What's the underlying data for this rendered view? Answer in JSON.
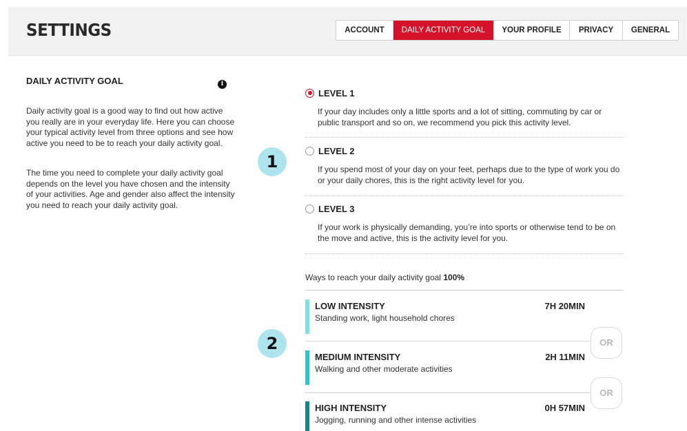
{
  "header": {
    "title": "SETTINGS",
    "tabs": [
      {
        "label": "ACCOUNT",
        "active": false
      },
      {
        "label": "DAILY ACTIVITY GOAL",
        "active": true
      },
      {
        "label": "YOUR PROFILE",
        "active": false
      },
      {
        "label": "PRIVACY",
        "active": false
      },
      {
        "label": "GENERAL",
        "active": false
      }
    ]
  },
  "sidebar": {
    "title": "DAILY ACTIVITY GOAL",
    "info_icon": "info-icon",
    "paragraph1": "Daily activity goal is a good way to find out how active you really are in your everyday life. Here you can choose your typical activity level from three options and see how active you need to be to reach your daily activity goal.",
    "paragraph2": "The time you need to complete your daily activity goal depends on the level you have chosen and the intensity of your activities. Age and gender also affect the intensity you need to reach your daily activity goal."
  },
  "annotations": {
    "one": "1",
    "two": "2"
  },
  "levels": [
    {
      "name": "LEVEL 1",
      "selected": true,
      "description": "If your day includes only a little sports and a lot of sitting, commuting by car or public transport and so on, we recommend you pick this activity level."
    },
    {
      "name": "LEVEL 2",
      "selected": false,
      "description": "If you spend most of your day on your feet, perhaps due to the type of work you do or your daily chores, this is the right activity level for you."
    },
    {
      "name": "LEVEL 3",
      "selected": false,
      "description": "If your work is physically demanding, you’re into sports or otherwise tend to be on the move and active, this is the activity level for you."
    }
  ],
  "ways": {
    "text": "Ways to reach your daily activity goal ",
    "percent": "100%"
  },
  "intensities": [
    {
      "name": "LOW INTENSITY",
      "description": "Standing work, light household chores",
      "time": "7H 20MIN",
      "color": "#7fe0ec"
    },
    {
      "name": "MEDIUM INTENSITY",
      "description": "Walking and other moderate activities",
      "time": "2H 11MIN",
      "color": "#2bc3d6"
    },
    {
      "name": "HIGH INTENSITY",
      "description": "Jogging, running and other intense activities",
      "time": "0H 57MIN",
      "color": "#13868f"
    }
  ],
  "or_label": "OR",
  "colors": {
    "accent": "#d6122a",
    "bubble": "#aee4ee"
  }
}
